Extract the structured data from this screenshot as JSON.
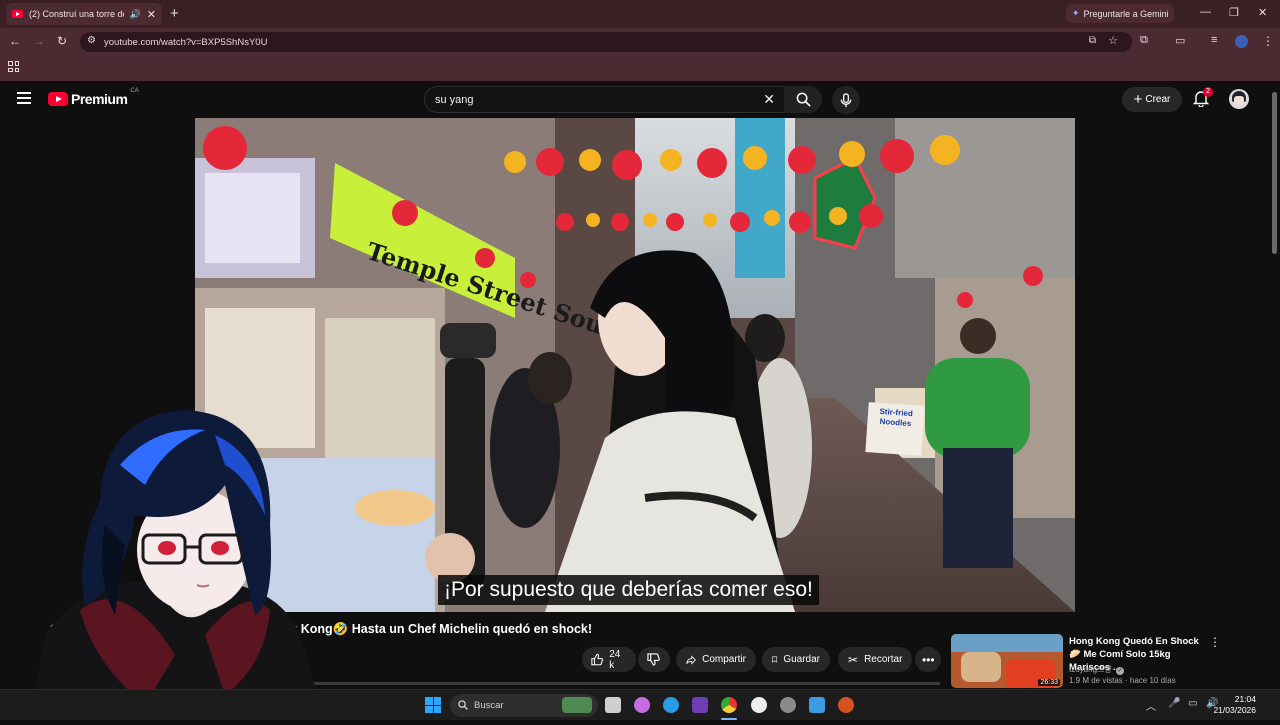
{
  "browser": {
    "tab_title": "(2) Construí una torre de D",
    "gemini_label": "Preguntarle a Gemini",
    "url": "youtube.com/watch?v=BXP5ShNsY0U"
  },
  "youtube": {
    "logo_text": "Premium",
    "region": "CA",
    "search_value": "su yang",
    "create_label": "Crear",
    "notification_count": "2"
  },
  "video": {
    "caption": "¡Por supuesto que deberías comer eso!",
    "sign_text": "Temple Street Souffle",
    "noodle_sign": "Stir-fried Noodles"
  },
  "below_video": {
    "title_start": "Co",
    "title_end": "g Kong🤣 Hasta un Chef Michelin quedó en shock!",
    "likes": "24 k",
    "share_label": "Compartir",
    "save_label": "Guardar",
    "clip_label": "Recortar"
  },
  "recommendation": {
    "title": "Hong Kong Quedó En Shock 🥟 Me Comí Solo 15kg Mariscos ...",
    "channel": "tzuyang쯔양",
    "meta": "1.9 M de vistas · hace 10 días",
    "duration": "26:33"
  },
  "taskbar": {
    "search_label": "Buscar",
    "time": "21:04",
    "date": "21/03/2026"
  },
  "colors": {
    "tabbar": "#3a1f25",
    "addressbar": "#4b2a31",
    "youtube_red": "#ff0033"
  }
}
